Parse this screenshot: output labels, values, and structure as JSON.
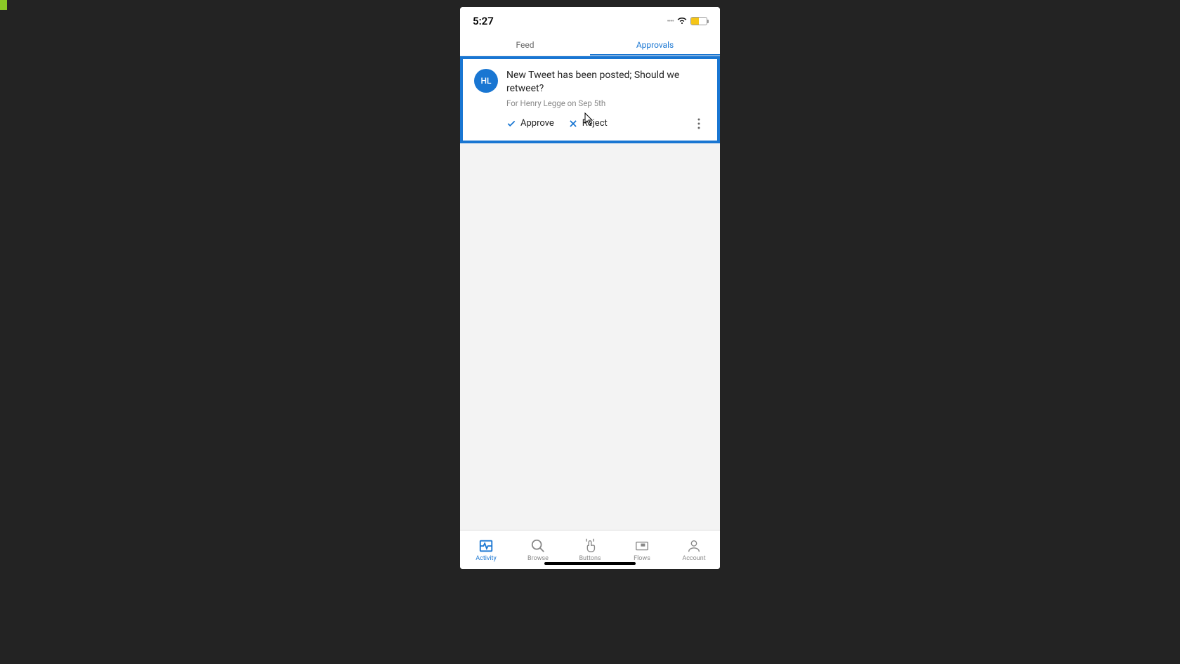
{
  "status_bar": {
    "time": "5:27"
  },
  "tabs": {
    "feed_label": "Feed",
    "approvals_label": "Approvals"
  },
  "approval_card": {
    "avatar_initials": "HL",
    "title": "New Tweet has been posted; Should we retweet?",
    "meta": "For Henry Legge on Sep 5th",
    "approve_label": "Approve",
    "reject_label": "Reject"
  },
  "bottom_nav": {
    "activity_label": "Activity",
    "browse_label": "Browse",
    "buttons_label": "Buttons",
    "flows_label": "Flows",
    "account_label": "Account"
  }
}
